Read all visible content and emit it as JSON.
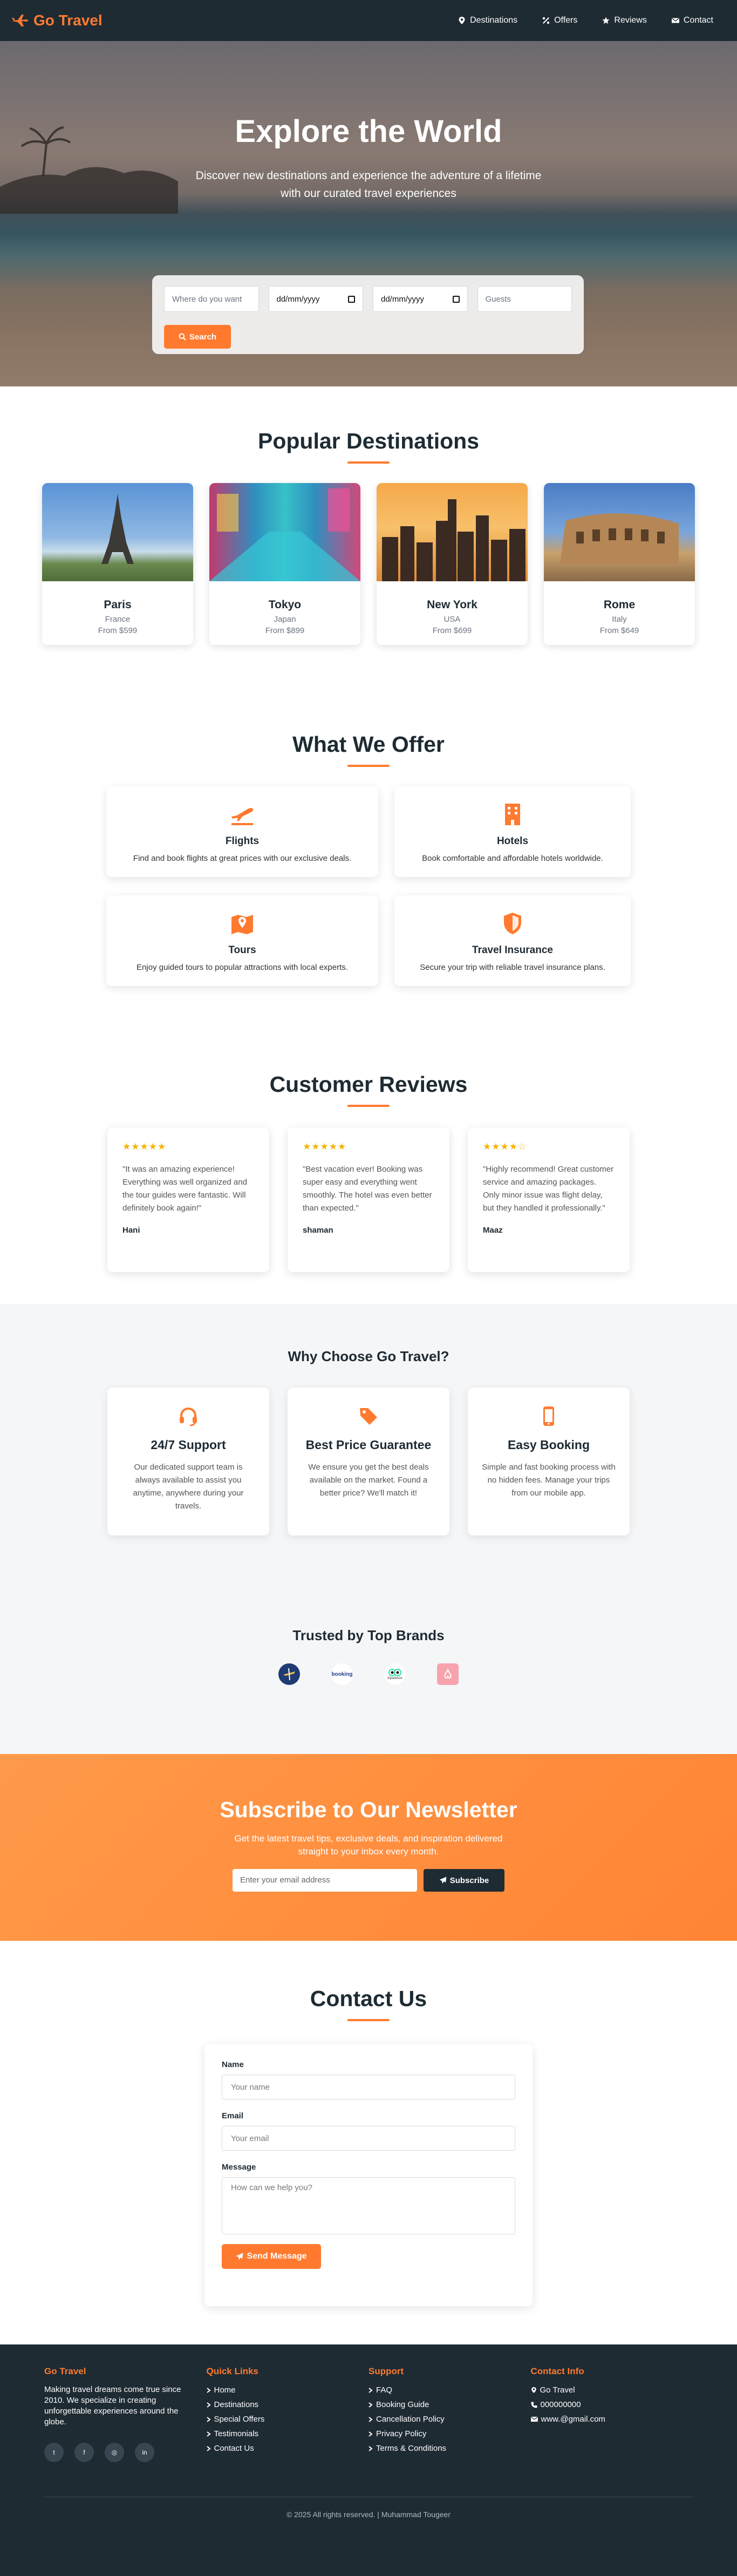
{
  "nav": {
    "brand": "Go Travel",
    "links": [
      "Destinations",
      "Offers",
      "Reviews",
      "Contact"
    ]
  },
  "hero": {
    "title": "Explore the World",
    "subtitle_line1": "Discover new destinations and experience the adventure of a lifetime",
    "subtitle_line2": "with our curated travel experiences",
    "search": {
      "where_placeholder": "Where do you want",
      "checkin_value": "dd/mm/yyyy",
      "checkout_value": "dd/mm/yyyy",
      "guests_placeholder": "Guests",
      "button": "Search"
    }
  },
  "destinations": {
    "title": "Popular Destinations",
    "items": [
      {
        "name": "Paris",
        "country": "France",
        "price": "From $599"
      },
      {
        "name": "Tokyo",
        "country": "Japan",
        "price": "From $899"
      },
      {
        "name": "New York",
        "country": "USA",
        "price": "From $699"
      },
      {
        "name": "Rome",
        "country": "Italy",
        "price": "From $649"
      }
    ]
  },
  "offers": {
    "title": "What We Offer",
    "items": [
      {
        "title": "Flights",
        "text": "Find and book flights at great prices with our exclusive deals.",
        "icon": "plane-icon"
      },
      {
        "title": "Hotels",
        "text": "Book comfortable and affordable hotels worldwide.",
        "icon": "hotel-icon"
      },
      {
        "title": "Tours",
        "text": "Enjoy guided tours to popular attractions with local experts.",
        "icon": "map-icon"
      },
      {
        "title": "Travel Insurance",
        "text": "Secure your trip with reliable travel insurance plans.",
        "icon": "shield-icon"
      }
    ]
  },
  "reviews": {
    "title": "Customer Reviews",
    "items": [
      {
        "stars": "★★★★★",
        "text": "\"It was an amazing experience! Everything was well organized and the tour guides were fantastic. Will definitely book again!\"",
        "name": "Hani"
      },
      {
        "stars": "★★★★★",
        "text": "\"Best vacation ever! Booking was super easy and everything went smoothly. The hotel was even better than expected.\"",
        "name": "shaman"
      },
      {
        "stars": "★★★★☆",
        "text": "\"Highly recommend! Great customer service and amazing packages. Only minor issue was flight delay, but they handled it professionally.\"",
        "name": "Maaz"
      }
    ]
  },
  "why": {
    "title": "Why Choose Go Travel?",
    "items": [
      {
        "title": "24/7 Support",
        "text": "Our dedicated support team is always available to assist you anytime, anywhere during your travels.",
        "icon": "headset-icon"
      },
      {
        "title": "Best Price Guarantee",
        "text": "We ensure you get the best deals available on the market. Found a better price? We'll match it!",
        "icon": "tag-icon"
      },
      {
        "title": "Easy Booking",
        "text": "Simple and fast booking process with no hidden fees. Manage your trips from our mobile app.",
        "icon": "phone-icon"
      }
    ]
  },
  "brands": {
    "title": "Trusted by Top Brands",
    "logos": [
      "airline",
      "booking",
      "tripadvisor",
      "airbnb"
    ],
    "logo_texts": [
      "booking",
      "tripadvisor"
    ]
  },
  "newsletter": {
    "title": "Subscribe to Our Newsletter",
    "text_line1": "Get the latest travel tips, exclusive deals, and inspiration delivered",
    "text_line2": "straight to your inbox every month.",
    "placeholder": "Enter your email address",
    "button": "Subscribe"
  },
  "contact": {
    "title": "Contact Us",
    "name_label": "Name",
    "name_placeholder": "Your name",
    "email_label": "Email",
    "email_placeholder": "Your email",
    "message_label": "Message",
    "message_placeholder": "How can we help you?",
    "button": "Send Message"
  },
  "footer": {
    "brand_title": "Go Travel",
    "about": "Making travel dreams come true since 2010. We specialize in creating unforgettable experiences around the globe.",
    "quick_title": "Quick Links",
    "quick_links": [
      "Home",
      "Destinations",
      "Special Offers",
      "Testimonials",
      "Contact Us"
    ],
    "support_title": "Support",
    "support_links": [
      "FAQ",
      "Booking Guide",
      "Cancellation Policy",
      "Privacy Policy",
      "Terms & Conditions"
    ],
    "info_title": "Contact Info",
    "info": [
      "Go Travel",
      "000000000",
      "www.@gmail.com"
    ],
    "copyright": "© 2025 All rights reserved. | Muhammad Tougeer"
  },
  "colors": {
    "accent": "#ff7a2f",
    "dark": "#1e2b33"
  }
}
